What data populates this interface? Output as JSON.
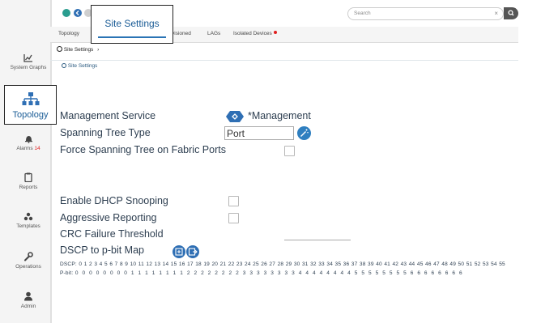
{
  "sidebar": {
    "items": [
      {
        "label": "System Graphs",
        "icon": "line-chart-icon"
      },
      {
        "label": "Topology",
        "icon": "topology-icon"
      },
      {
        "label": "Alarms",
        "badge": "14",
        "icon": "bell-icon"
      },
      {
        "label": "Reports",
        "icon": "clipboard-icon"
      },
      {
        "label": "Templates",
        "icon": "templates-icon"
      },
      {
        "label": "Operations",
        "icon": "wrench-icon"
      },
      {
        "label": "Admin",
        "icon": "user-icon"
      }
    ]
  },
  "header": {
    "search_placeholder": "Search",
    "clear": "×"
  },
  "tabs": [
    {
      "label": "Topology"
    },
    {
      "label": "Site Settings",
      "active": true
    },
    {
      "label": "visioned"
    },
    {
      "label": "LAGs"
    },
    {
      "label": "Isolated Devices",
      "alert": true
    }
  ],
  "breadcrumb": {
    "label": "Site Settings",
    "sep": "›"
  },
  "section_title": "Site Settings",
  "settings": {
    "management_service": {
      "label": "Management Service",
      "value": "*Management"
    },
    "spanning_tree_type": {
      "label": "Spanning Tree Type",
      "value": "Port"
    },
    "force_stp": {
      "label": "Force Spanning Tree on Fabric Ports"
    },
    "dhcp_snooping": {
      "label": "Enable DHCP Snooping"
    },
    "aggressive_reporting": {
      "label": "Aggressive Reporting"
    },
    "crc_threshold": {
      "label": "CRC Failure Threshold"
    },
    "dscp_map": {
      "label": "DSCP to p-bit Map"
    }
  },
  "dscp": {
    "dscp_prefix": "DSCP:",
    "pbit_prefix": "P-bit:",
    "dscp_values": "0 1 2 3 4 5 6 7 8 9 10 11 12 13 14 15 16 17 18 19 20 21 22 23 24 25 26 27 28 29 30 31 32 33 34 35 36 37 38 39 40 41 42 43 44 45 46 47 48 49 50 51 52 53 54 55",
    "pbit_values": "0 0 0 0 0 0 0 0 1 1 1 1 1 1 1 1 2 2 2 2 2 2 2 2 3 3 3 3 3 3 3 3 4 4 4 4 4 4 4 4 5 5 5 5 5 5 5 5 6 6 6 6 6 6 6 6"
  },
  "colors": {
    "accent": "#2f7fc0",
    "text": "#2d3e50",
    "alert": "#e02020"
  }
}
